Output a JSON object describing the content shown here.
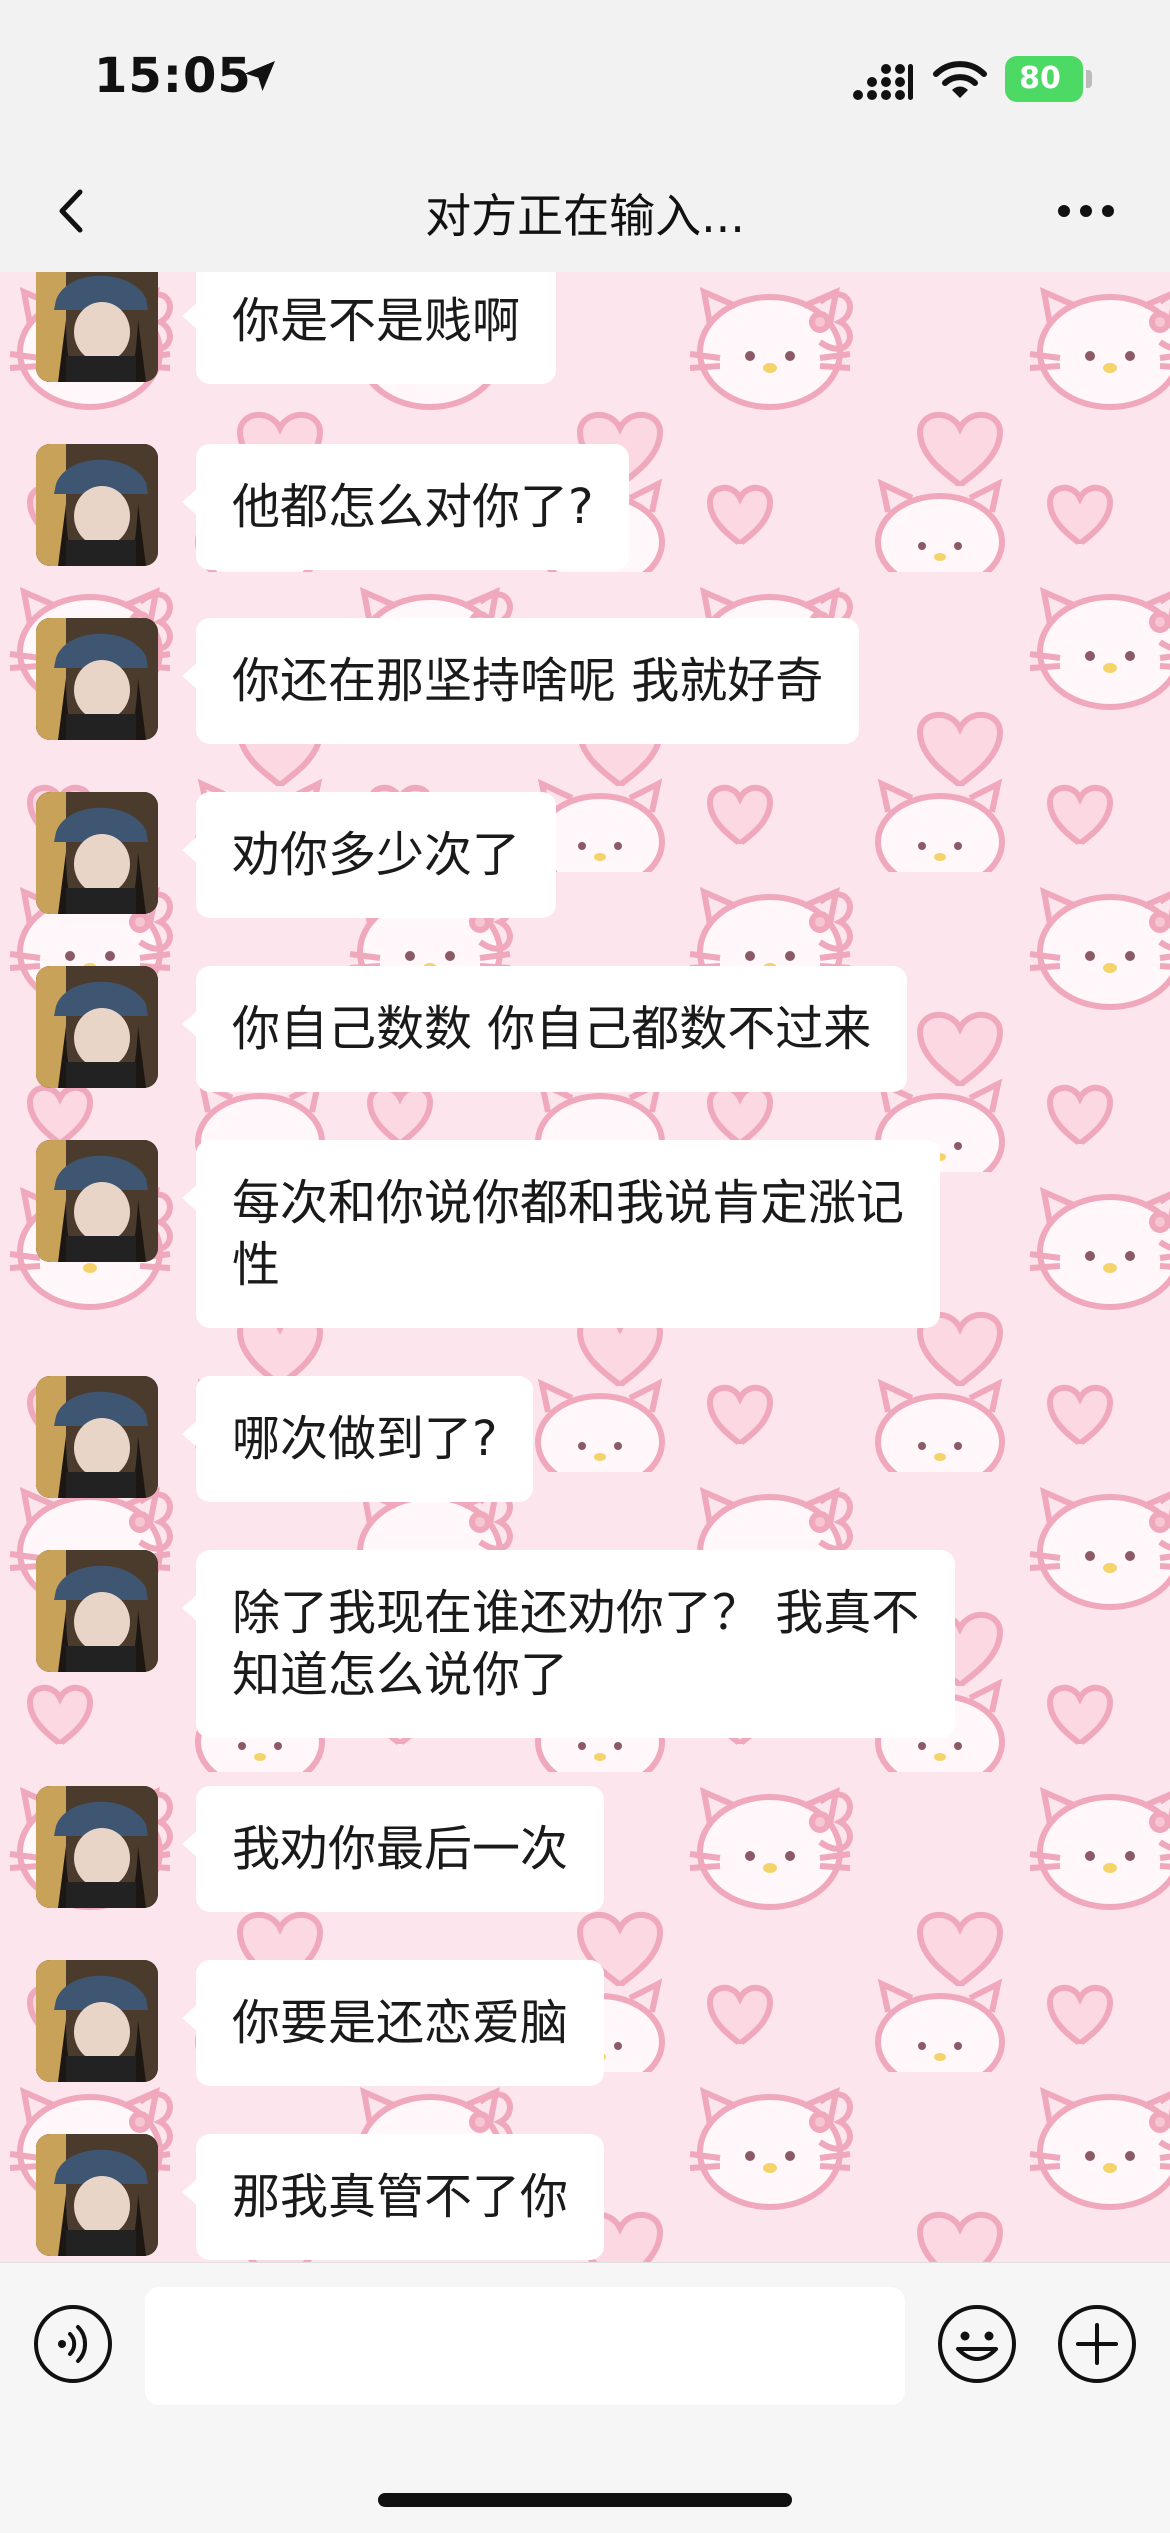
{
  "status_bar": {
    "time": "15:05",
    "battery": "80"
  },
  "header": {
    "title": "对方正在输入..."
  },
  "messages": [
    {
      "text": "你是不是贱啊"
    },
    {
      "text": "他都怎么对你了?"
    },
    {
      "text": "你还在那坚持啥呢 我就好奇"
    },
    {
      "text": "劝你多少次了"
    },
    {
      "text": "你自己数数 你自己都数不过来"
    },
    {
      "text": "每次和你说你都和我说肯定涨记\n性"
    },
    {
      "text": "哪次做到了?"
    },
    {
      "text": "除了我现在谁还劝你了？ 我真不\n知道怎么说你了"
    },
    {
      "text": "我劝你最后一次"
    },
    {
      "text": "你要是还恋爱脑"
    },
    {
      "text": "那我真管不了你"
    }
  ],
  "input": {
    "value": ""
  },
  "colors": {
    "wallpaper": "#fce5ec",
    "bubble": "#ffffff",
    "battery": "#4cd964",
    "motif": "#f0a8bc"
  },
  "icons": [
    "location-arrow-icon",
    "signal-icon",
    "wifi-icon",
    "back-icon",
    "more-icon",
    "voice-icon",
    "emoji-icon",
    "plus-icon"
  ]
}
